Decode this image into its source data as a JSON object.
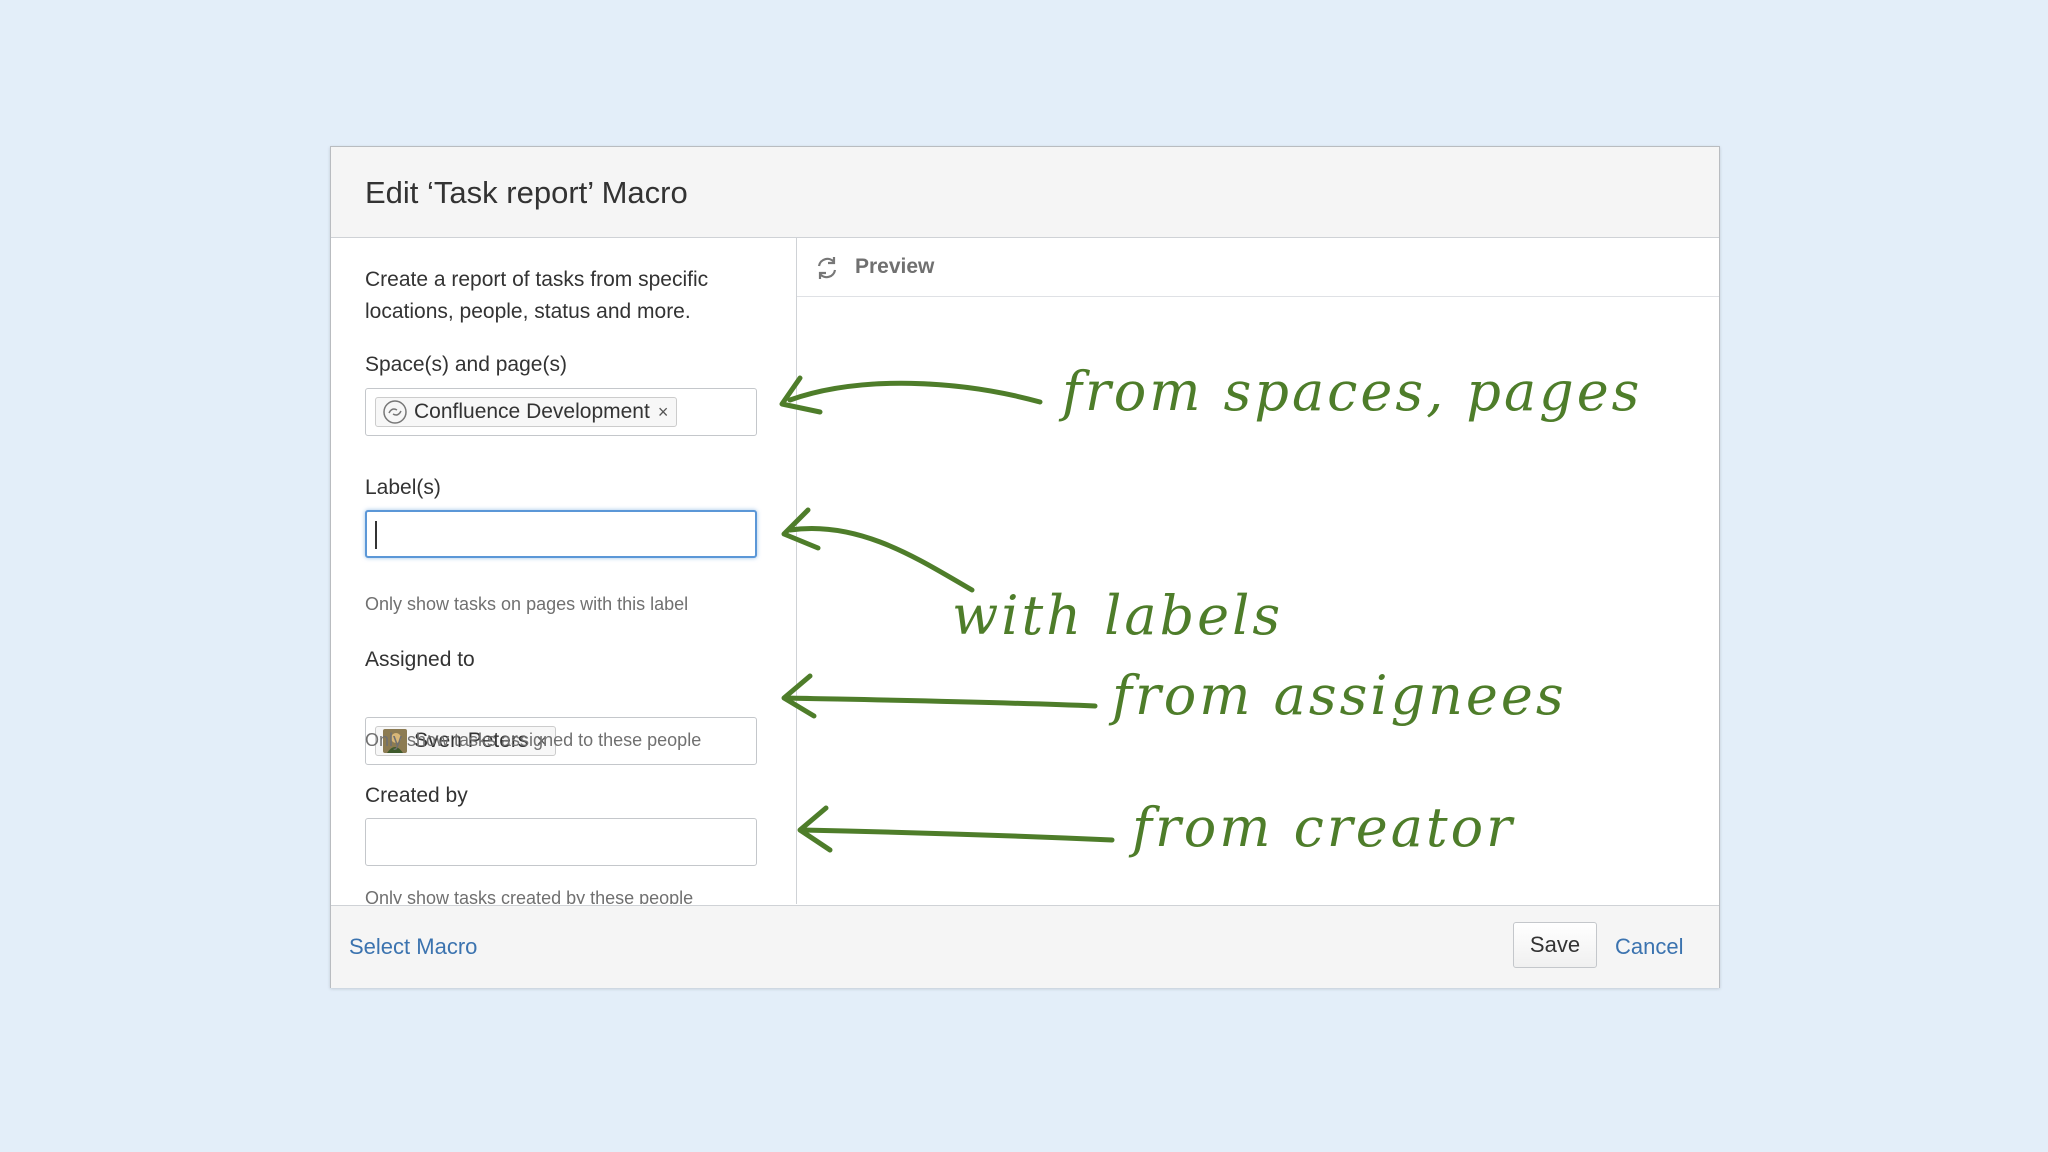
{
  "dialog": {
    "title": "Edit ‘Task report’ Macro",
    "description": "Create a report of tasks from specific locations, people, status and more."
  },
  "fields": {
    "spaces": {
      "label": "Space(s) and page(s)",
      "token": "Confluence Development",
      "token_remove": "×"
    },
    "labels": {
      "label": "Label(s)",
      "value": "",
      "hint": "Only show tasks on pages with this label"
    },
    "assigned": {
      "label": "Assigned to",
      "token": "Sven Peters",
      "token_remove": "×",
      "hint": "Only show tasks assigned to these people"
    },
    "created": {
      "label": "Created by",
      "value": "",
      "hint": "Only show tasks created by these people"
    }
  },
  "preview": {
    "label": "Preview",
    "icon": "refresh-icon"
  },
  "footer": {
    "select_macro": "Select Macro",
    "save": "Save",
    "cancel": "Cancel"
  },
  "annotations": {
    "spaces": "from spaces, pages",
    "labels": "with labels",
    "assignees": "from assignees",
    "creator": "from creator",
    "color": "#4e7d2a"
  },
  "colors": {
    "background": "#e3eef9",
    "link": "#3b73af",
    "focus": "#5b97d7"
  }
}
